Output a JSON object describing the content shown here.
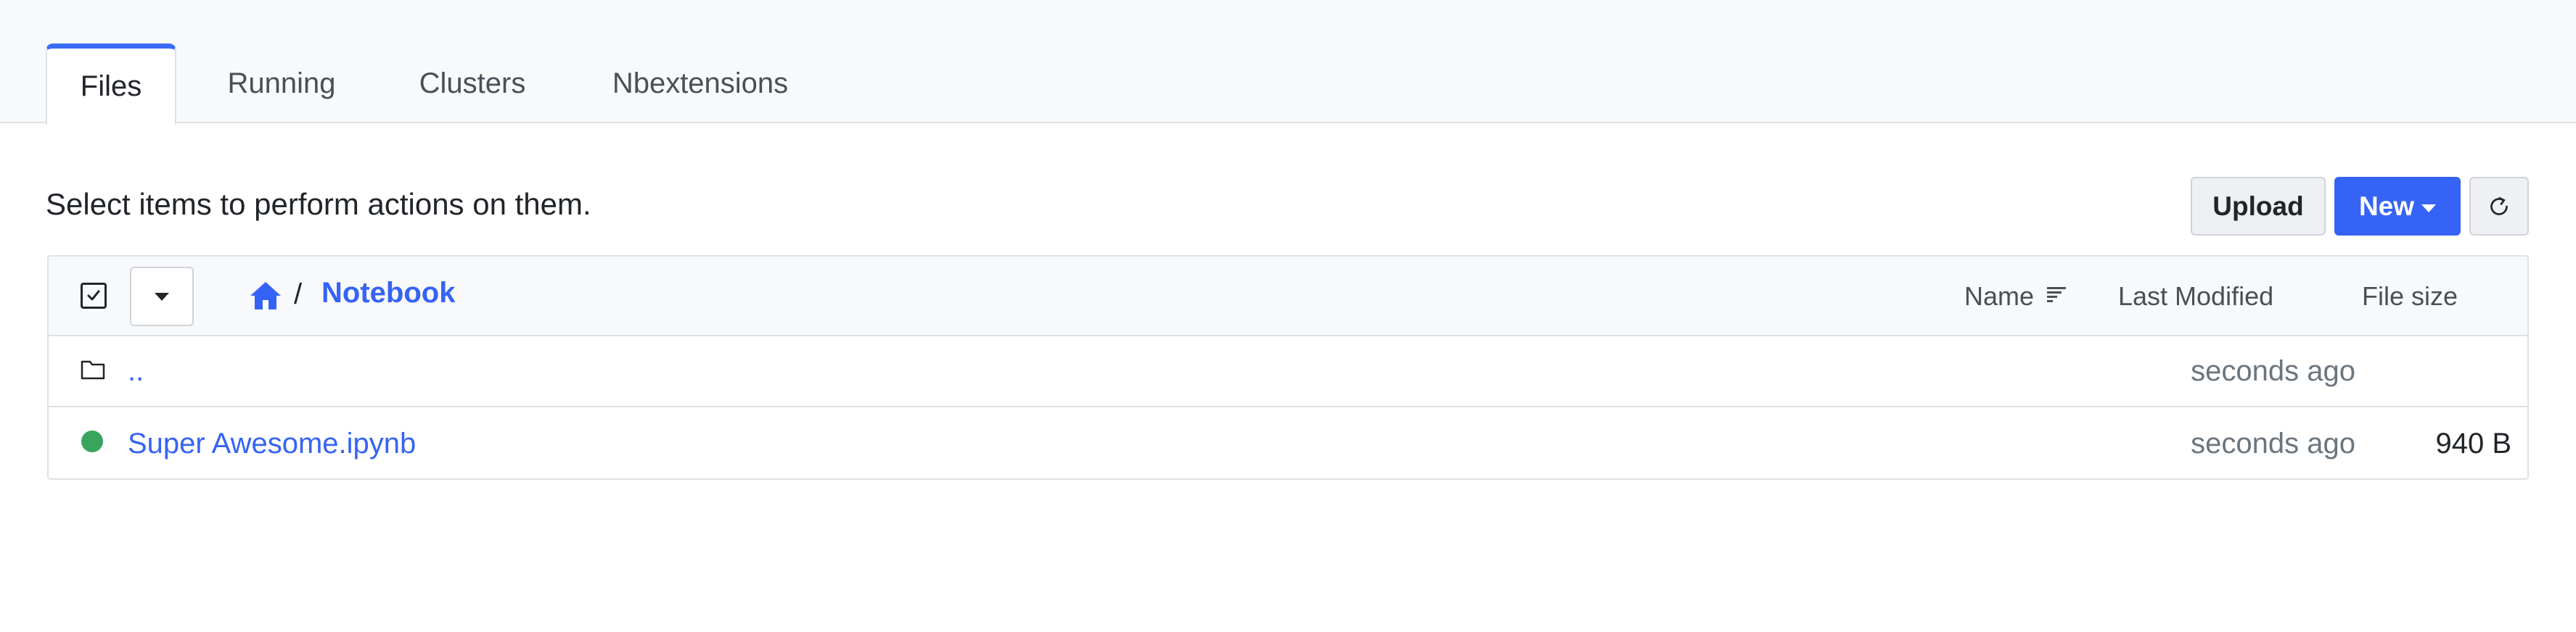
{
  "tabs": [
    {
      "label": "Files",
      "active": true
    },
    {
      "label": "Running",
      "active": false
    },
    {
      "label": "Clusters",
      "active": false
    },
    {
      "label": "Nbextensions",
      "active": false
    }
  ],
  "toolbar": {
    "hint": "Select items to perform actions on them.",
    "upload_label": "Upload",
    "new_label": "New",
    "refresh_icon": "refresh-icon"
  },
  "list": {
    "breadcrumb": {
      "home_icon": "home-icon",
      "separator": "/",
      "current": "Notebook"
    },
    "columns": {
      "name": "Name",
      "modified": "Last Modified",
      "size": "File size"
    },
    "rows": [
      {
        "type": "folder",
        "name": "..",
        "modified": "seconds ago",
        "size": ""
      },
      {
        "type": "notebook",
        "status": "running",
        "name": "Super Awesome.ipynb",
        "modified": "seconds ago",
        "size": "940 B"
      }
    ]
  },
  "colors": {
    "accent": "#3563f5",
    "running": "#38a45c"
  }
}
